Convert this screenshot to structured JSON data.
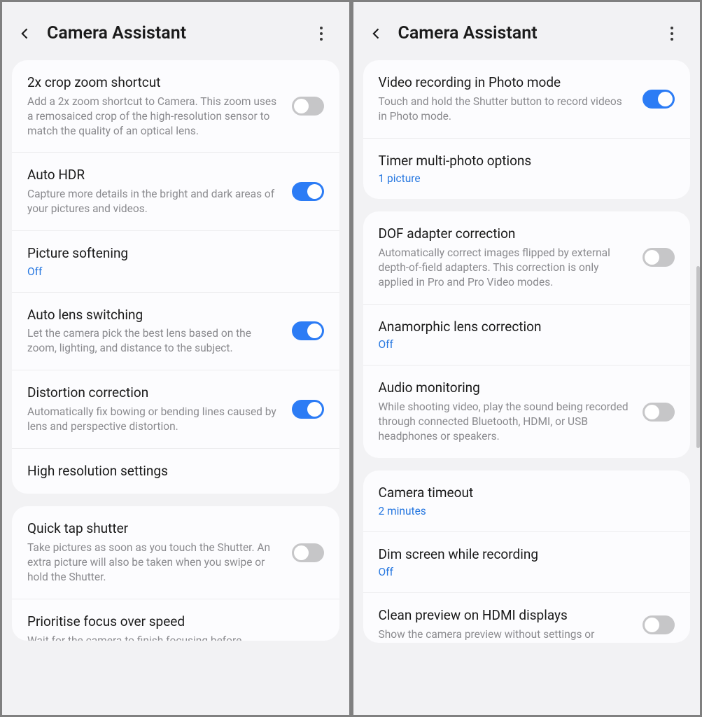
{
  "left": {
    "title": "Camera Assistant",
    "items": [
      {
        "title": "2x crop zoom shortcut",
        "desc": "Add a 2x zoom shortcut to Camera. This zoom uses a remosaiced crop of the high-resolution sensor to match the quality of an optical lens.",
        "toggle": false
      },
      {
        "title": "Auto HDR",
        "desc": "Capture more details in the bright and dark areas of your pictures and videos.",
        "toggle": true
      },
      {
        "title": "Picture softening",
        "value": "Off"
      },
      {
        "title": "Auto lens switching",
        "desc": "Let the camera pick the best lens based on the zoom, lighting, and distance to the subject.",
        "toggle": true
      },
      {
        "title": "Distortion correction",
        "desc": "Automatically fix bowing or bending lines caused by lens and perspective distortion.",
        "toggle": true
      },
      {
        "title": "High resolution settings"
      }
    ],
    "group2": [
      {
        "title": "Quick tap shutter",
        "desc": "Take pictures as soon as you touch the Shutter. An extra picture will also be taken when you swipe or hold the Shutter.",
        "toggle": false
      },
      {
        "title": "Prioritise focus over speed",
        "desc": "Wait for the camera to finish focusing before"
      }
    ]
  },
  "right": {
    "title": "Camera Assistant",
    "group1": [
      {
        "title": "Video recording in Photo mode",
        "desc": "Touch and hold the Shutter button to record videos in Photo mode.",
        "toggle": true
      },
      {
        "title": "Timer multi-photo options",
        "value": "1 picture"
      }
    ],
    "group2": [
      {
        "title": "DOF adapter correction",
        "desc": "Automatically correct images flipped by external depth-of-field adapters. This correction is only applied in Pro and Pro Video modes.",
        "toggle": false
      },
      {
        "title": "Anamorphic lens correction",
        "value": "Off"
      },
      {
        "title": "Audio monitoring",
        "desc": "While shooting video, play the sound being recorded through connected Bluetooth, HDMI, or USB headphones or speakers.",
        "toggle": false
      }
    ],
    "group3": [
      {
        "title": "Camera timeout",
        "value": "2 minutes"
      },
      {
        "title": "Dim screen while recording",
        "value": "Off"
      },
      {
        "title": "Clean preview on HDMI displays",
        "desc": "Show the camera preview without settings or buttons on HDMI-connected displays.",
        "toggle": false
      }
    ]
  }
}
